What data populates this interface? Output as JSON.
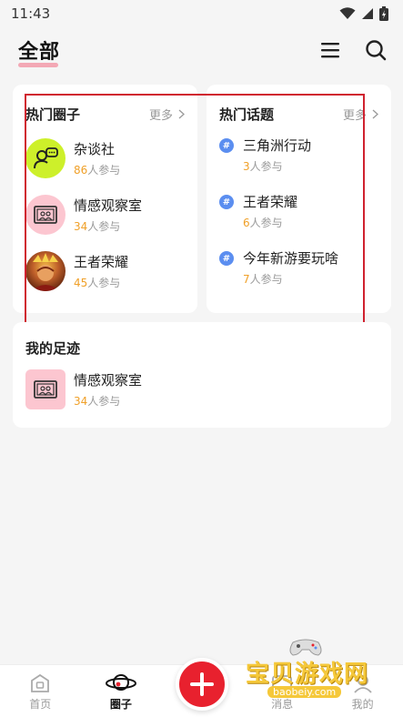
{
  "status_bar": {
    "time": "11:43"
  },
  "header": {
    "title": "全部"
  },
  "hot_circles": {
    "title": "热门圈子",
    "more_label": "更多",
    "items": [
      {
        "name": "杂谈社",
        "count": "86",
        "suffix": "人参与",
        "icon": "chat-user-icon"
      },
      {
        "name": "情感观察室",
        "count": "34",
        "suffix": "人参与",
        "icon": "photo-frame-icon"
      },
      {
        "name": "王者荣耀",
        "count": "45",
        "suffix": "人参与",
        "icon": "game-hero-avatar"
      }
    ]
  },
  "hot_topics": {
    "title": "热门话题",
    "more_label": "更多",
    "hash_symbol": "#",
    "items": [
      {
        "name": "三角洲行动",
        "count": "3",
        "suffix": "人参与"
      },
      {
        "name": "王者荣耀",
        "count": "6",
        "suffix": "人参与"
      },
      {
        "name": "今年新游要玩啥",
        "count": "7",
        "suffix": "人参与"
      }
    ]
  },
  "footprint": {
    "title": "我的足迹",
    "items": [
      {
        "name": "情感观察室",
        "count": "34",
        "suffix": "人参与"
      }
    ]
  },
  "bottom_nav": {
    "home_label": "首页",
    "circle_label": "圈子",
    "message_label": "消息",
    "mine_label": "我的"
  },
  "watermark": {
    "main": "宝贝游戏网",
    "url": "baobeiy.com"
  },
  "colors": {
    "accent": "#e8212e",
    "count": "#f0a028",
    "topic": "#5b8ef0",
    "lime": "#cdf02a",
    "pink": "#fcc6d0"
  }
}
